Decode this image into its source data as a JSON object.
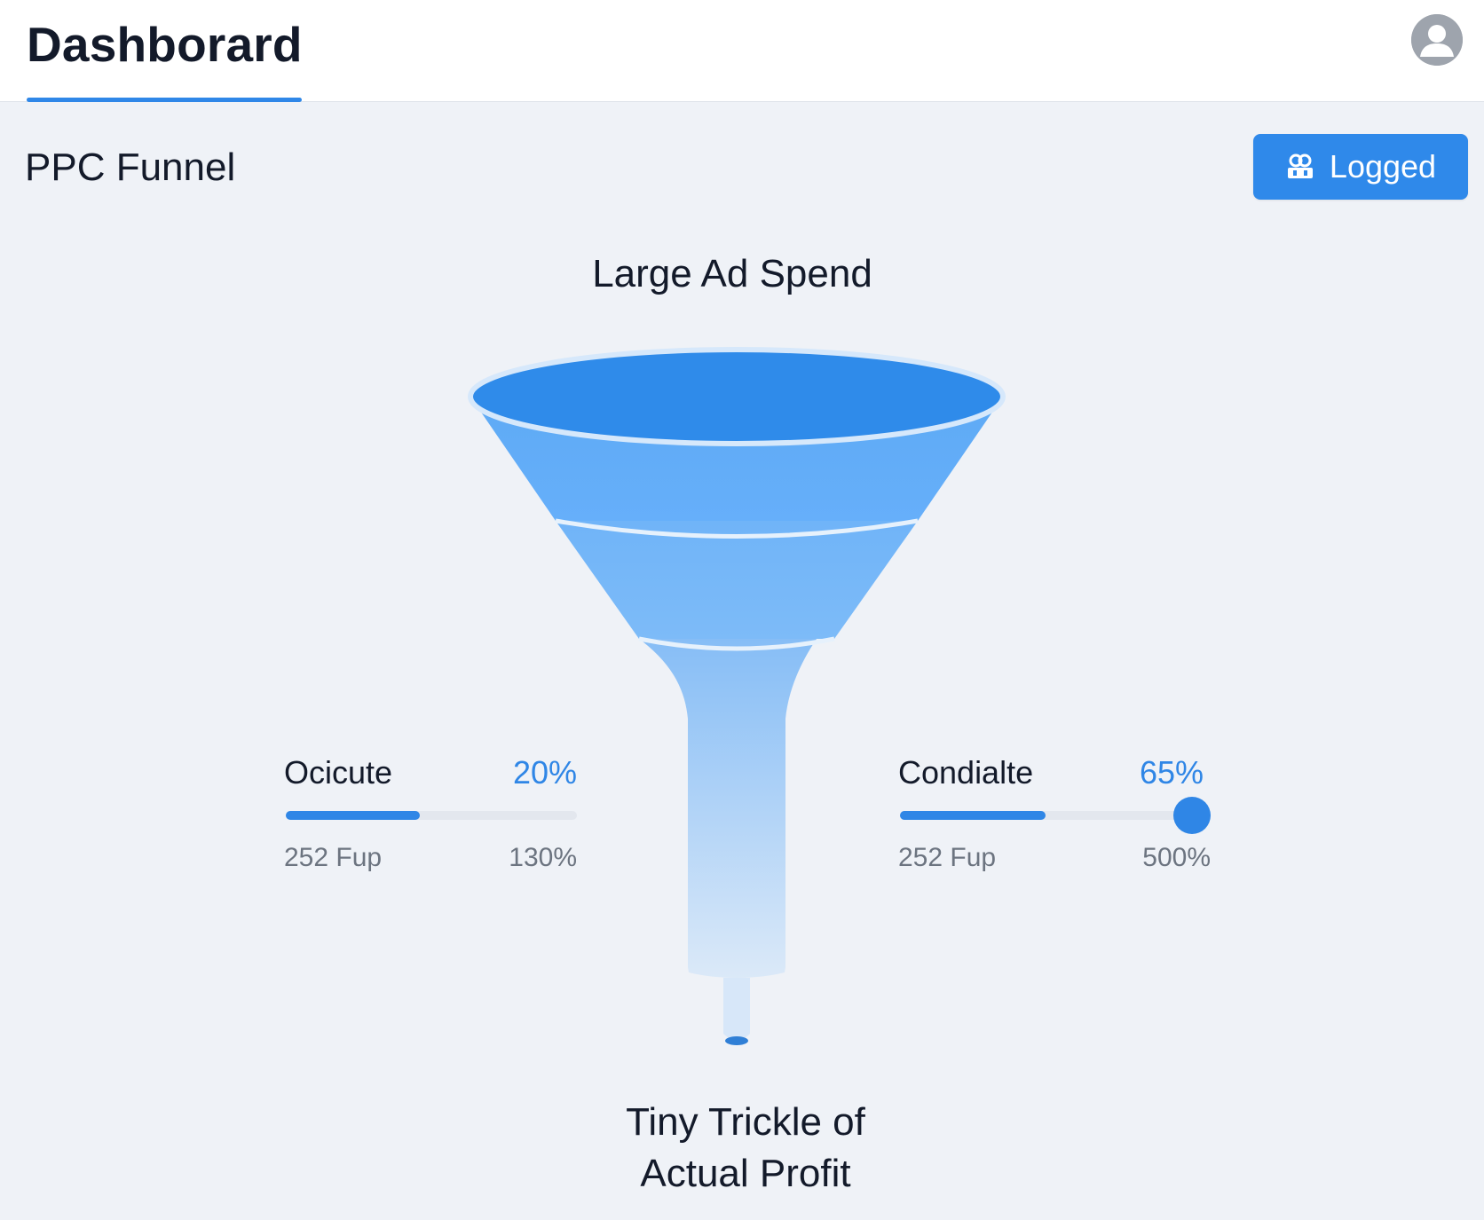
{
  "header": {
    "title": "Dashborard"
  },
  "section": {
    "title": "PPC Funnel",
    "button_label": "Logged"
  },
  "funnel": {
    "top_label": "Large Ad Spend",
    "bottom_label_line1": "Tiny Trickle of",
    "bottom_label_line2": "Actual Profit"
  },
  "metrics": [
    {
      "name": "Ocicute",
      "percent": "20%",
      "fill_fraction": 0.46,
      "sub_left": "252 Fup",
      "sub_right": "130%",
      "has_knob": false
    },
    {
      "name": "Condialte",
      "percent": "65%",
      "fill_fraction": 0.51,
      "sub_left": "252 Fup",
      "sub_right": "500%",
      "has_knob": true
    }
  ],
  "colors": {
    "accent": "#2f86e6",
    "background": "#eff2f7"
  },
  "icons": {
    "avatar": "user-avatar-icon",
    "button": "users-icon"
  }
}
